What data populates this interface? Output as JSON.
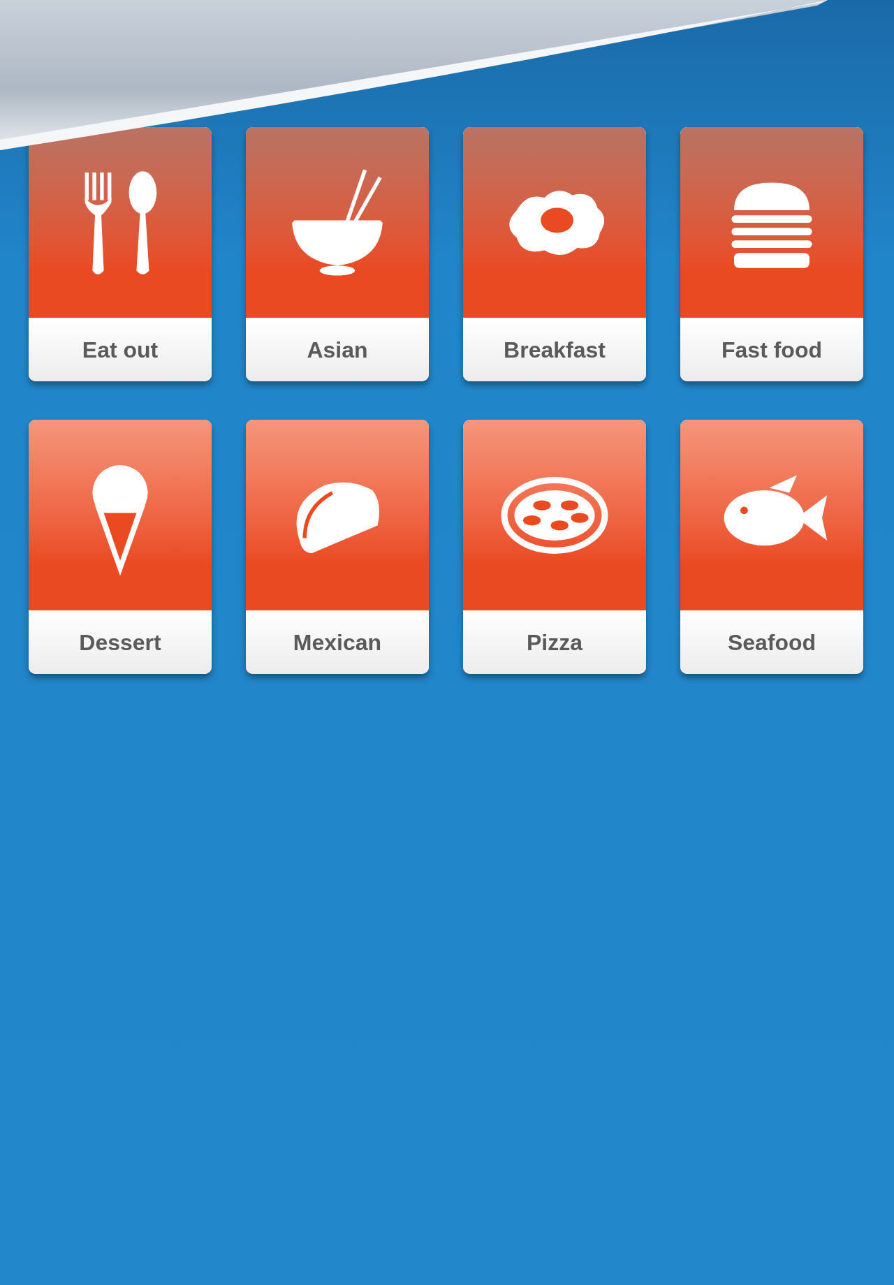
{
  "categories": [
    {
      "label": "Eat out"
    },
    {
      "label": "Asian"
    },
    {
      "label": "Breakfast"
    },
    {
      "label": "Fast food"
    },
    {
      "label": "Dessert"
    },
    {
      "label": "Mexican"
    },
    {
      "label": "Pizza"
    },
    {
      "label": "Seafood"
    }
  ]
}
